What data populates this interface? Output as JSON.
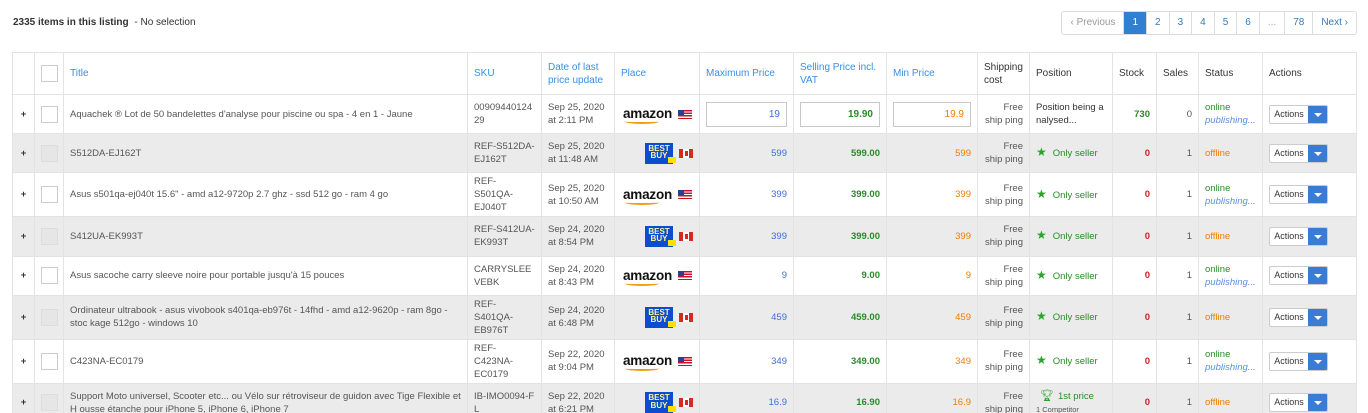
{
  "summary": {
    "count_text": "2335 items in this listing",
    "selection_text": "- No selection"
  },
  "pagination": {
    "prev": "‹ Previous",
    "pages": [
      "1",
      "2",
      "3",
      "4",
      "5",
      "6",
      "...",
      "78"
    ],
    "active": "1",
    "next": "Next ›"
  },
  "columns": {
    "title": "Title",
    "sku": "SKU",
    "date": "Date of last price update",
    "place": "Place",
    "max_price": "Maximum Price",
    "selling_price": "Selling Price incl. VAT",
    "min_price": "Min Price",
    "shipping": "Shipping cost",
    "position": "Position",
    "stock": "Stock",
    "sales": "Sales",
    "status": "Status",
    "actions": "Actions"
  },
  "colors": {
    "link_blue": "#3a8ee6",
    "green": "#2a8a2a",
    "orange": "#f07d00",
    "red": "#d02020",
    "accent": "#3a7bd5"
  },
  "rows": [
    {
      "expand": "+",
      "title": "Aquachek ® Lot de 50 bandelettes d'analyse pour piscine ou spa - 4 en 1 - Jaune",
      "sku": "00909440124 29",
      "date": "Sep 25, 2020 at 2:11 PM",
      "place": "amazon",
      "flag": "us",
      "max": "19",
      "sell": "19.90",
      "min": "19.9",
      "ship": "Free ship ping",
      "position": "Position being a nalysed...",
      "position_icon": "none",
      "position_sub": "",
      "stock": "730",
      "stock_color": "green",
      "sales": "0",
      "status": "online",
      "status_sub": "publishing...",
      "action": "Actions",
      "editable": true
    },
    {
      "expand": "+",
      "title": "S512DA-EJ162T",
      "sku": "REF-S512DA-EJ162T",
      "date": "Sep 25, 2020 at 11:48 AM",
      "place": "bestbuy",
      "flag": "ca",
      "max": "599",
      "sell": "599.00",
      "min": "599",
      "ship": "Free ship ping",
      "position": "Only seller",
      "position_icon": "star-icon",
      "position_sub": "",
      "stock": "0",
      "stock_color": "red",
      "sales": "1",
      "status": "offline",
      "status_sub": "",
      "action": "Actions",
      "editable": false
    },
    {
      "expand": "+",
      "title": "Asus s501qa-ej040t 15.6\" - amd a12-9720p 2.7 ghz - ssd 512 go - ram 4 go",
      "sku": "REF-S501QA-EJ040T",
      "date": "Sep 25, 2020 at 10:50 AM",
      "place": "amazon",
      "flag": "us",
      "max": "399",
      "sell": "399.00",
      "min": "399",
      "ship": "Free ship ping",
      "position": "Only seller",
      "position_icon": "star-icon",
      "position_sub": "",
      "stock": "0",
      "stock_color": "red",
      "sales": "1",
      "status": "online",
      "status_sub": "publishing...",
      "action": "Actions",
      "editable": false
    },
    {
      "expand": "+",
      "title": "S412UA-EK993T",
      "sku": "REF-S412UA-EK993T",
      "date": "Sep 24, 2020 at 8:54 PM",
      "place": "bestbuy",
      "flag": "ca",
      "max": "399",
      "sell": "399.00",
      "min": "399",
      "ship": "Free ship ping",
      "position": "Only seller",
      "position_icon": "star-icon",
      "position_sub": "",
      "stock": "0",
      "stock_color": "red",
      "sales": "1",
      "status": "offline",
      "status_sub": "",
      "action": "Actions",
      "editable": false
    },
    {
      "expand": "+",
      "title": "Asus sacoche carry sleeve noire pour portable jusqu'à 15 pouces",
      "sku": "CARRYSLEE VEBK",
      "date": "Sep 24, 2020 at 8:43 PM",
      "place": "amazon",
      "flag": "us",
      "max": "9",
      "sell": "9.00",
      "min": "9",
      "ship": "Free ship ping",
      "position": "Only seller",
      "position_icon": "star-icon",
      "position_sub": "",
      "stock": "0",
      "stock_color": "red",
      "sales": "1",
      "status": "online",
      "status_sub": "publishing...",
      "action": "Actions",
      "editable": false
    },
    {
      "expand": "+",
      "title": "Ordinateur ultrabook - asus vivobook s401qa-eb976t - 14fhd - amd a12-9620p - ram 8go - stoc kage 512go - windows 10",
      "sku": "REF-S401QA-EB976T",
      "date": "Sep 24, 2020 at 6:48 PM",
      "place": "bestbuy",
      "flag": "ca",
      "max": "459",
      "sell": "459.00",
      "min": "459",
      "ship": "Free ship ping",
      "position": "Only seller",
      "position_icon": "star-icon",
      "position_sub": "",
      "stock": "0",
      "stock_color": "red",
      "sales": "1",
      "status": "offline",
      "status_sub": "",
      "action": "Actions",
      "editable": false
    },
    {
      "expand": "+",
      "title": "C423NA-EC0179",
      "sku": "REF-C423NA-EC0179",
      "date": "Sep 22, 2020 at 9:04 PM",
      "place": "amazon",
      "flag": "us",
      "max": "349",
      "sell": "349.00",
      "min": "349",
      "ship": "Free ship ping",
      "position": "Only seller",
      "position_icon": "star-icon",
      "position_sub": "",
      "stock": "0",
      "stock_color": "red",
      "sales": "1",
      "status": "online",
      "status_sub": "publishing...",
      "action": "Actions",
      "editable": false
    },
    {
      "expand": "+",
      "title": "Support Moto universel, Scooter etc... ou Vélo sur rétroviseur de guidon avec Tige Flexible et H ousse étanche pour iPhone 5, iPhone 6, iPhone 7",
      "sku": "IB-IMO0094-F L",
      "date": "Sep 22, 2020 at 6:21 PM",
      "place": "bestbuy",
      "flag": "ca",
      "max": "16.9",
      "sell": "16.90",
      "min": "16.9",
      "ship": "Free ship ping",
      "position": "1st price",
      "position_icon": "trophy-icon",
      "position_sub": "1 Competitor",
      "stock": "0",
      "stock_color": "red",
      "sales": "1",
      "status": "offline",
      "status_sub": "",
      "action": "Actions",
      "editable": false
    }
  ]
}
